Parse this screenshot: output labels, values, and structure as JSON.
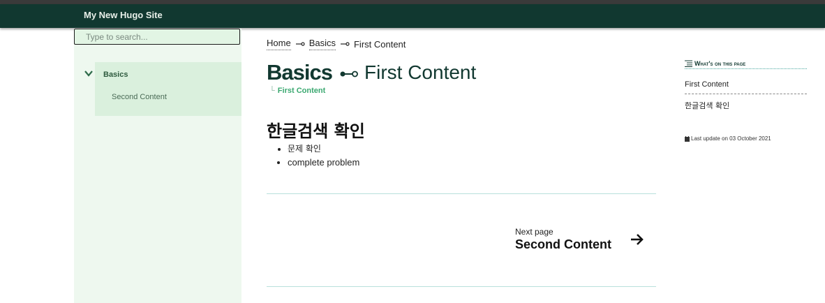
{
  "site": {
    "title": "My New Hugo Site"
  },
  "search": {
    "placeholder": "Type to search..."
  },
  "sidebar": {
    "items": [
      {
        "label": "Basics",
        "expanded": true
      },
      {
        "label": "Second Content"
      }
    ]
  },
  "breadcrumb": {
    "items": [
      "Home",
      "Basics",
      "First Content"
    ]
  },
  "page": {
    "section": "Basics",
    "title": "First Content",
    "subtree": "First Content"
  },
  "content": {
    "heading": "한글검색 확인",
    "bullets": [
      "문제 확인",
      "complete problem"
    ]
  },
  "pager": {
    "next_label": "Next page",
    "next_title": "Second Content"
  },
  "toc": {
    "title": "What's on this page",
    "items": [
      "First Content",
      "한글검색 확인"
    ]
  },
  "footer": {
    "last_update": "Last update on 03 October 2021"
  },
  "colors": {
    "navbar": "#113830",
    "sidebar": "#eef8ef",
    "accent": "#3aa870"
  }
}
